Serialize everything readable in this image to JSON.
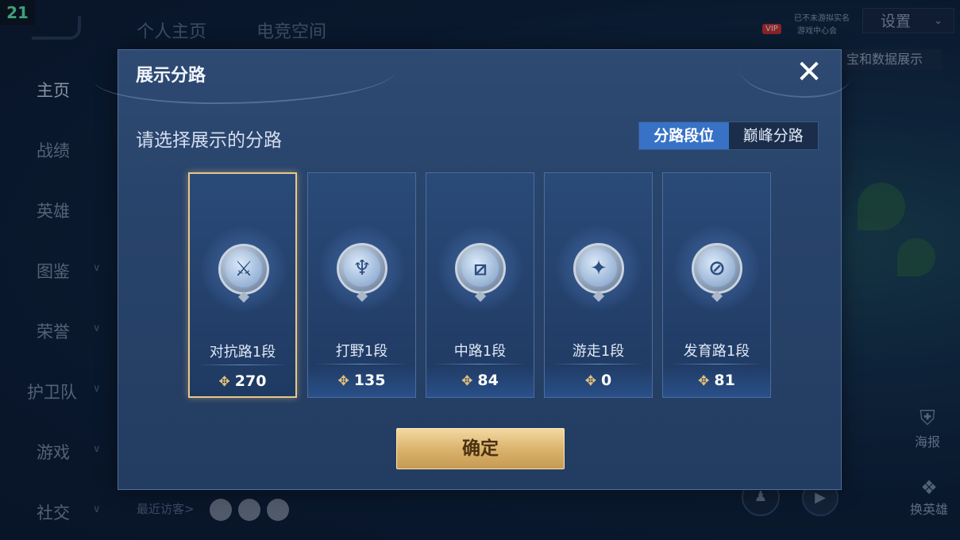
{
  "overlay": {
    "fps_counter": "21"
  },
  "background": {
    "sidebar": [
      {
        "label": "主页",
        "active": true,
        "has_chevron": false
      },
      {
        "label": "战绩",
        "active": false,
        "has_chevron": false
      },
      {
        "label": "英雄",
        "active": false,
        "has_chevron": false
      },
      {
        "label": "图鉴",
        "active": false,
        "has_chevron": true
      },
      {
        "label": "荣誉",
        "active": false,
        "has_chevron": true
      },
      {
        "label": "护卫队",
        "active": false,
        "has_chevron": true
      },
      {
        "label": "游戏",
        "active": false,
        "has_chevron": true
      },
      {
        "label": "社交",
        "active": false,
        "has_chevron": true
      }
    ],
    "top_tabs": [
      "个人主页",
      "电竞空间"
    ],
    "vip": {
      "badge": "VIP",
      "line1": "已不未游拟实名",
      "line2": "游戏中心会"
    },
    "settings_label": "设置",
    "right_label": "宝和数据展示",
    "poster_label": "海报",
    "swap_hero_label": "换英雄",
    "recent_visitors_label": "最近访客>"
  },
  "dialog": {
    "title": "展示分路",
    "subtitle": "请选择展示的分路",
    "toggle": {
      "options": [
        "分路段位",
        "巅峰分路"
      ],
      "selected": 0
    },
    "lanes": [
      {
        "name": "对抗路1段",
        "score": "270",
        "icon": "clash-lane-icon",
        "glyph": "⚔",
        "selected": true
      },
      {
        "name": "打野1段",
        "score": "135",
        "icon": "jungle-icon",
        "glyph": "♆",
        "selected": false
      },
      {
        "name": "中路1段",
        "score": "84",
        "icon": "mid-lane-icon",
        "glyph": "⧄",
        "selected": false
      },
      {
        "name": "游走1段",
        "score": "0",
        "icon": "roam-icon",
        "glyph": "✦",
        "selected": false
      },
      {
        "name": "发育路1段",
        "score": "81",
        "icon": "farm-lane-icon",
        "glyph": "⊘",
        "selected": false
      }
    ],
    "confirm_label": "确定",
    "close_glyph": "✕"
  },
  "colors": {
    "accent_gold": "#e8c78b",
    "toggle_active": "#3772c6",
    "dialog_bg": "#2a4670"
  }
}
